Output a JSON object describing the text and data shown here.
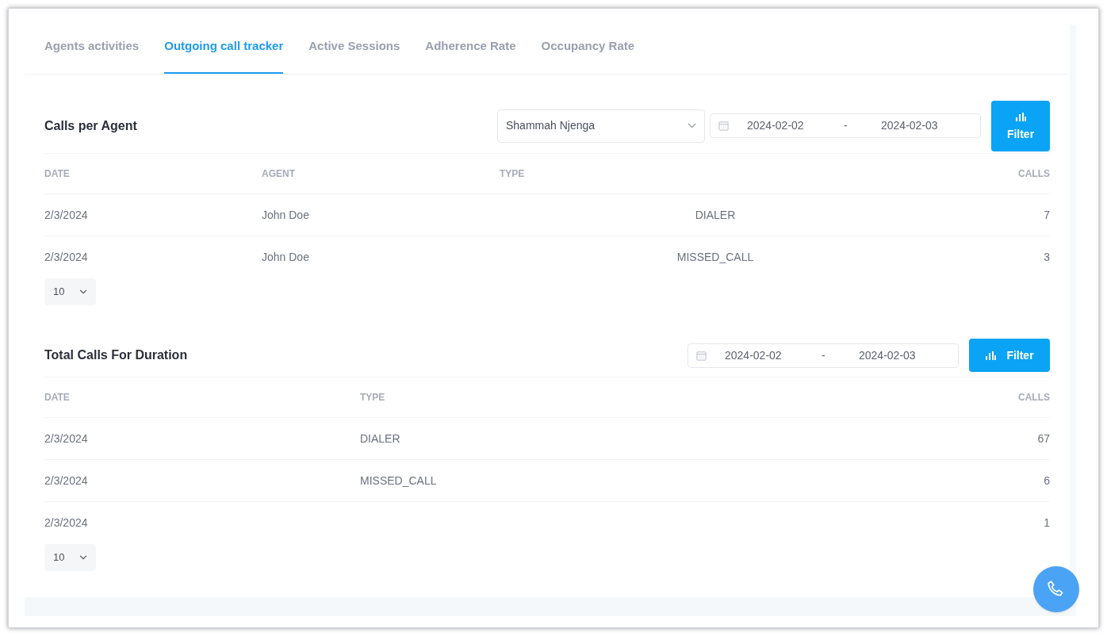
{
  "tabs": [
    {
      "label": "Agents activities",
      "selected": false
    },
    {
      "label": "Outgoing call tracker",
      "selected": true
    },
    {
      "label": "Active Sessions",
      "selected": false
    },
    {
      "label": "Adherence Rate",
      "selected": false
    },
    {
      "label": "Occupancy Rate",
      "selected": false
    }
  ],
  "calls_per_agent": {
    "title": "Calls per Agent",
    "agent_select": {
      "value": "Shammah Njenga"
    },
    "date_range": {
      "start": "2024-02-02",
      "separator": "-",
      "end": "2024-02-03"
    },
    "filter_button": "Filter",
    "table": {
      "columns": [
        "DATE",
        "AGENT",
        "TYPE",
        "CALLS"
      ],
      "rows": [
        {
          "date": "2/3/2024",
          "agent": "John Doe",
          "type": "DIALER",
          "calls": "7"
        },
        {
          "date": "2/3/2024",
          "agent": "John Doe",
          "type": "MISSED_CALL",
          "calls": "3"
        }
      ]
    },
    "page_size": "10"
  },
  "total_calls": {
    "title": "Total Calls For Duration",
    "date_range": {
      "start": "2024-02-02",
      "separator": "-",
      "end": "2024-02-03"
    },
    "filter_button": "Filter",
    "table": {
      "columns": [
        "DATE",
        "TYPE",
        "CALLS"
      ],
      "rows": [
        {
          "date": "2/3/2024",
          "type": "DIALER",
          "calls": "67"
        },
        {
          "date": "2/3/2024",
          "type": "MISSED_CALL",
          "calls": "6"
        },
        {
          "date": "2/3/2024",
          "calls": "1"
        }
      ]
    },
    "page_size": "10"
  }
}
